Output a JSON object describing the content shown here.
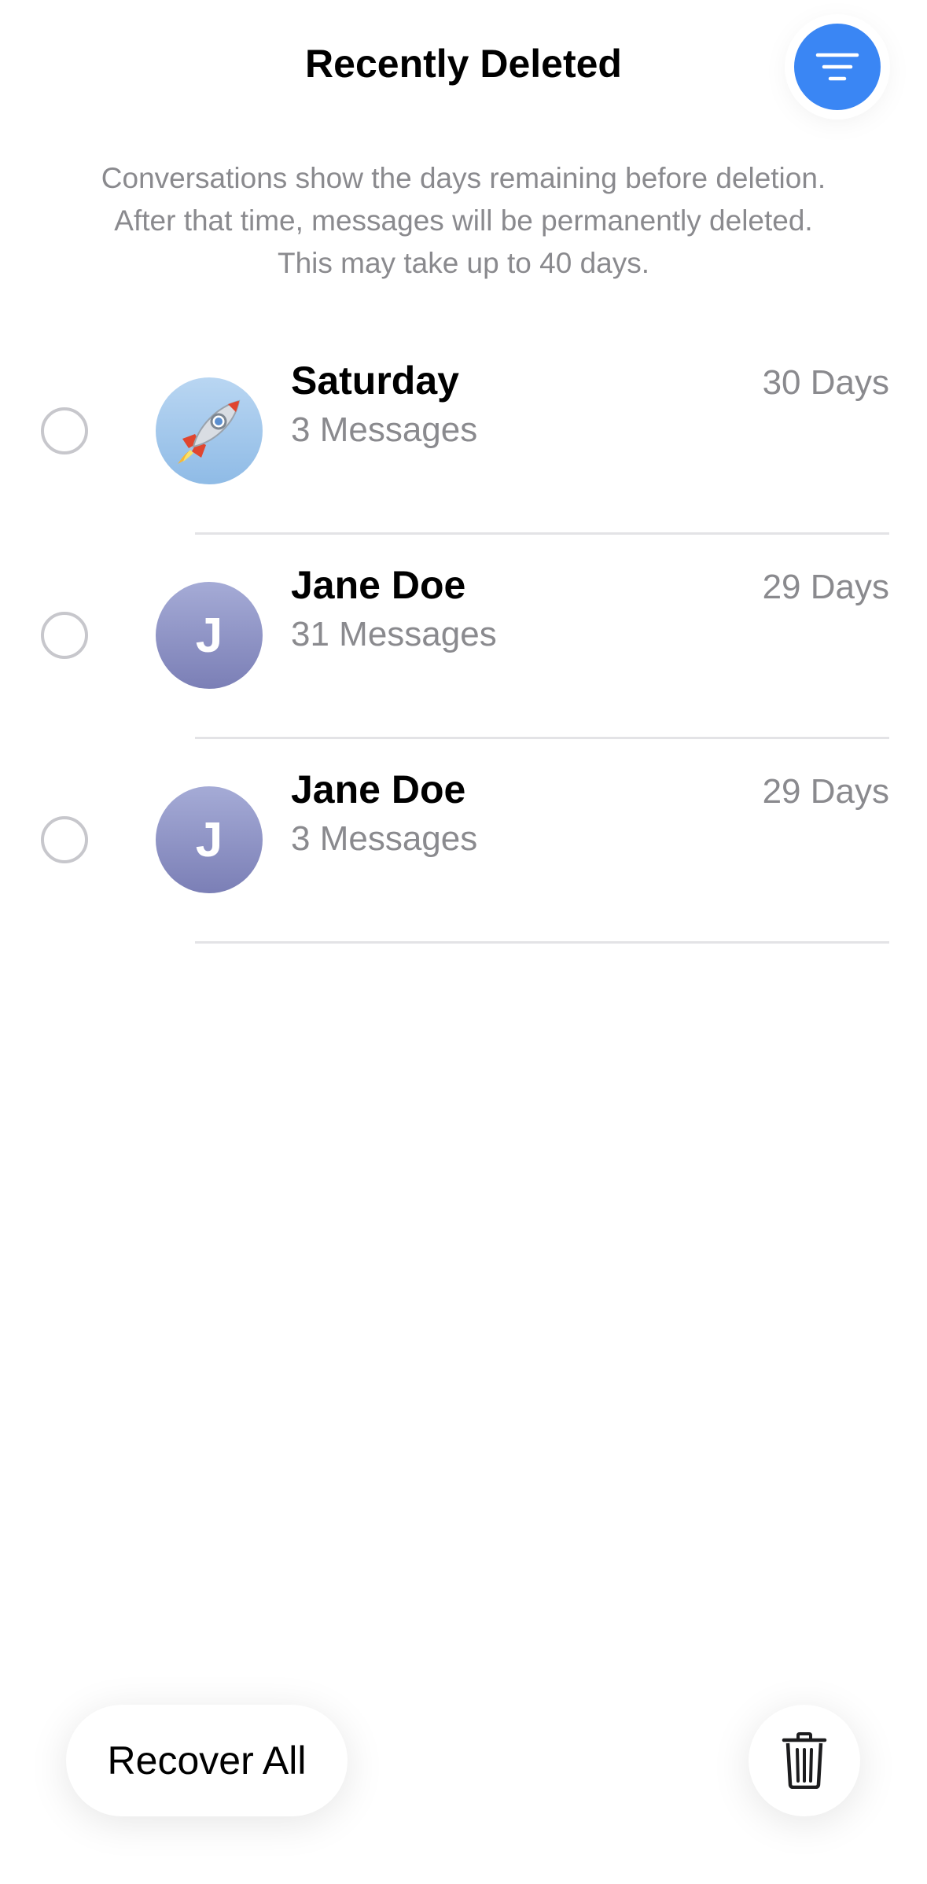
{
  "header": {
    "title": "Recently Deleted",
    "filter_icon": "filter-lines-icon",
    "accent_color": "#3a86f4"
  },
  "description": {
    "line1": "Conversations show the days remaining before deletion.",
    "line2": "After that time, messages will be permanently deleted.",
    "line3": "This may take up to 40 days."
  },
  "conversations": [
    {
      "name": "Saturday",
      "count": "3 Messages",
      "days": "30 Days",
      "avatar": "rocket-emoji"
    },
    {
      "name": "Jane Doe",
      "count": "31 Messages",
      "days": "29 Days",
      "avatar": "J"
    },
    {
      "name": "Jane Doe",
      "count": "3 Messages",
      "days": "29 Days",
      "avatar": "J"
    }
  ],
  "footer": {
    "recover_label": "Recover All",
    "trash_icon": "trash-icon"
  }
}
